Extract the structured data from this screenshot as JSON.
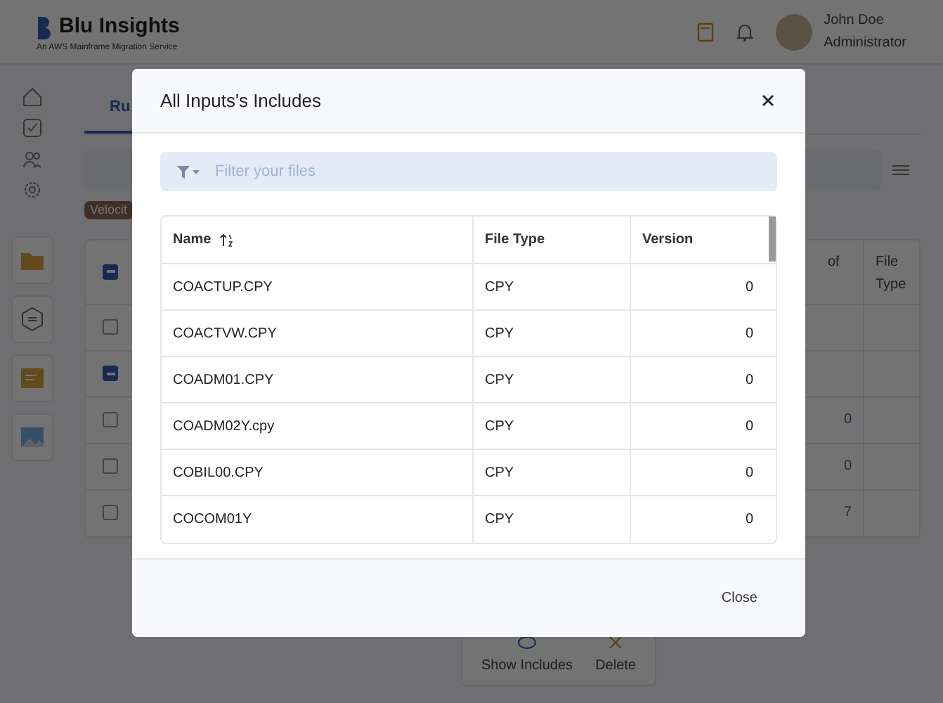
{
  "app": {
    "logo": "Blu Insights",
    "tagline": "An AWS Mainframe Migration Service"
  },
  "user": {
    "name": "John Doe",
    "role": "Administrator"
  },
  "tabs": [
    {
      "label": "Ru",
      "selected": true
    }
  ],
  "badge": "Velocit",
  "background_table": {
    "header_checked": true,
    "columns": [
      "of",
      "File Type"
    ],
    "rows": [
      {
        "checked": false
      },
      {
        "checked": true
      },
      {
        "checked": false,
        "value": "0"
      },
      {
        "checked": false,
        "value": "0"
      },
      {
        "checked": false,
        "value": "7"
      }
    ]
  },
  "actions": [
    {
      "kind": "show",
      "label": "Show Includes"
    },
    {
      "kind": "delete",
      "label": "Delete"
    }
  ],
  "dialog": {
    "title": "All Inputs's Includes",
    "filter": {
      "placeholder": "Filter your files"
    },
    "columns": [
      {
        "label": "Name",
        "sorted": true
      },
      {
        "label": "File Type"
      },
      {
        "label": "Version"
      }
    ],
    "rows": [
      [
        "COACTUP.CPY",
        "CPY",
        "0"
      ],
      [
        "COACTVW.CPY",
        "CPY",
        "0"
      ],
      [
        "COADM01.CPY",
        "CPY",
        "0"
      ],
      [
        "COADM02Y.cpy",
        "CPY",
        "0"
      ],
      [
        "COBIL00.CPY",
        "CPY",
        "0"
      ],
      [
        "COCOM01Y",
        "CPY",
        "0"
      ]
    ],
    "buttons": [
      "Close"
    ]
  }
}
